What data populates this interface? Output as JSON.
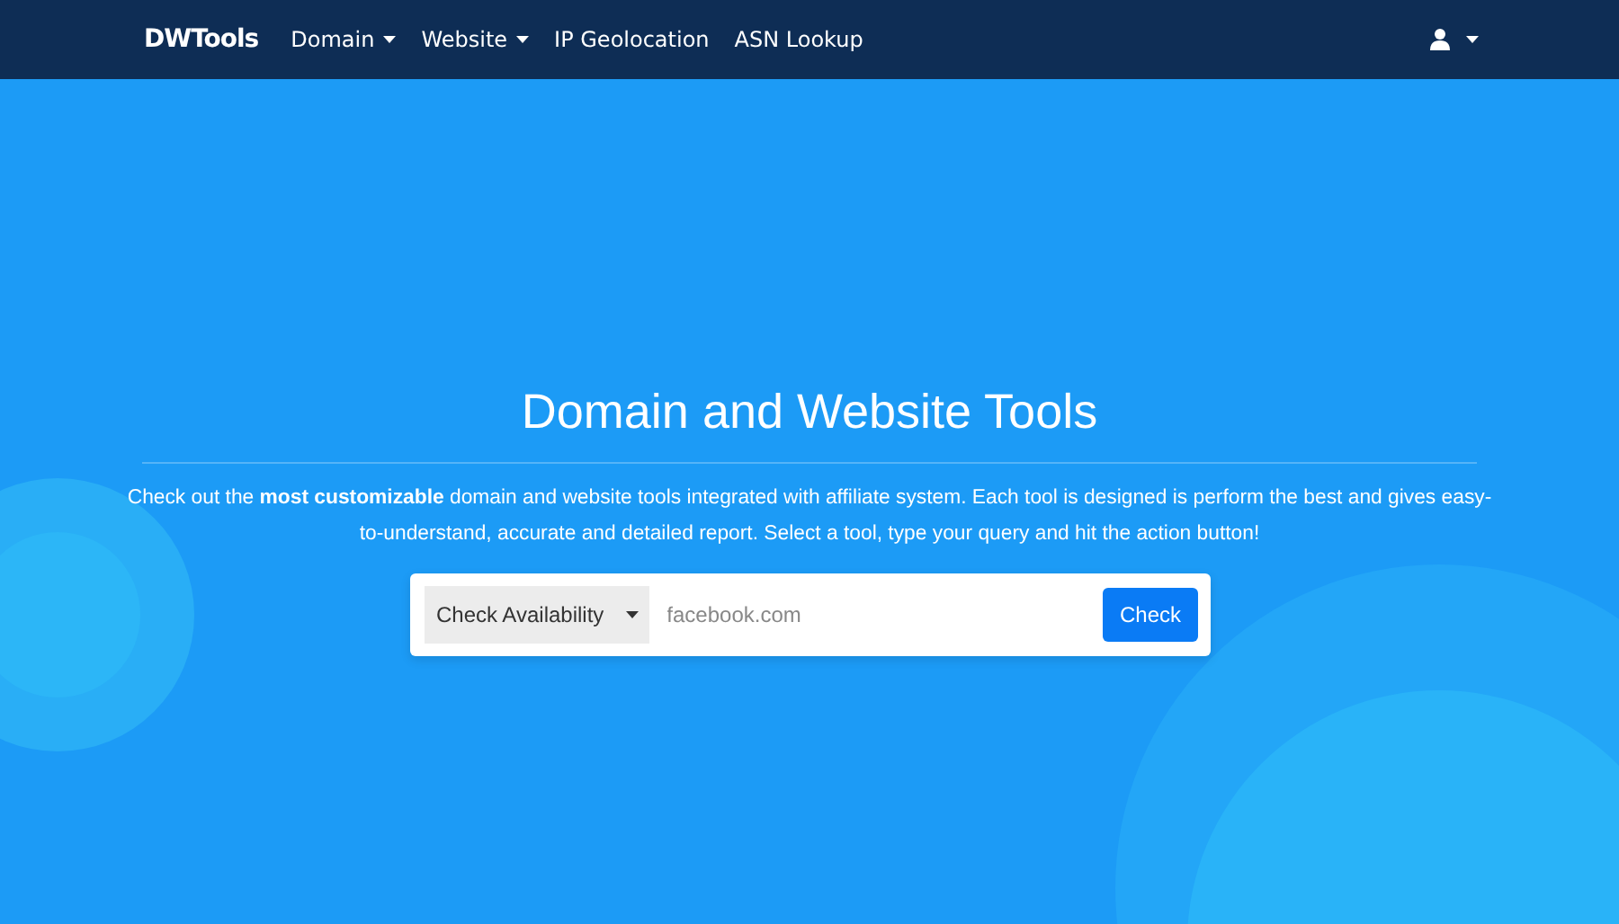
{
  "navbar": {
    "brand": "DWTools",
    "items": [
      {
        "label": "Domain",
        "dropdown": true
      },
      {
        "label": "Website",
        "dropdown": true
      },
      {
        "label": "IP Geolocation",
        "dropdown": false
      },
      {
        "label": "ASN Lookup",
        "dropdown": false
      }
    ],
    "user_menu": {
      "dropdown": true
    }
  },
  "hero": {
    "title": "Domain and Website Tools",
    "description": "Check out the **most customizable** domain and website tools integrated with affiliate system. Each tool is designed is perform the best and gives easy-to-understand, accurate and detailed report. Select a tool, type your query and hit the action button!",
    "search": {
      "tool_select": "Check Availability",
      "placeholder": "facebook.com",
      "button": "Check"
    }
  }
}
